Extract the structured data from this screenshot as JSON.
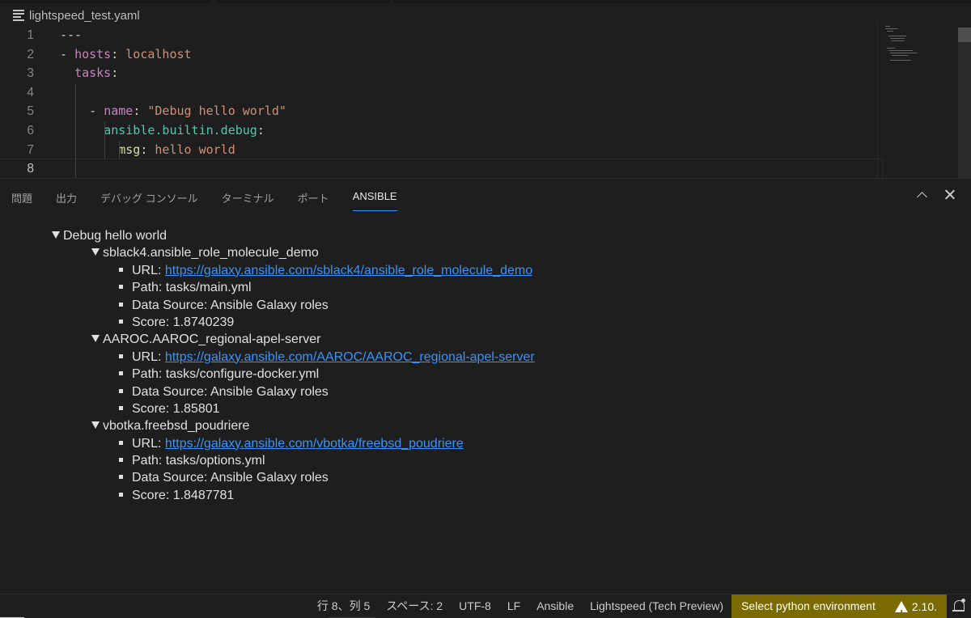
{
  "editor": {
    "filename": "lightspeed_test.yaml",
    "lines": [
      {
        "num": "1",
        "tokens": [
          [
            "plain",
            "---"
          ]
        ]
      },
      {
        "num": "2",
        "tokens": [
          [
            "dash",
            "- "
          ],
          [
            "k1",
            "hosts"
          ],
          [
            "plain",
            ": "
          ],
          [
            "str",
            "localhost"
          ]
        ]
      },
      {
        "num": "3",
        "tokens": [
          [
            "plain",
            "  "
          ],
          [
            "k1",
            "tasks"
          ],
          [
            "plain",
            ":"
          ]
        ]
      },
      {
        "num": "4",
        "tokens": []
      },
      {
        "num": "5",
        "tokens": [
          [
            "plain",
            "    "
          ],
          [
            "dash",
            "- "
          ],
          [
            "k1",
            "name"
          ],
          [
            "plain",
            ": "
          ],
          [
            "str",
            "\"Debug hello world\""
          ]
        ]
      },
      {
        "num": "6",
        "tokens": [
          [
            "plain",
            "      "
          ],
          [
            "k2",
            "ansible.builtin.debug"
          ],
          [
            "plain",
            ":"
          ]
        ]
      },
      {
        "num": "7",
        "tokens": [
          [
            "plain",
            "        "
          ],
          [
            "k3",
            "msg"
          ],
          [
            "plain",
            ": "
          ],
          [
            "str",
            "hello world"
          ]
        ]
      },
      {
        "num": "8",
        "tokens": []
      }
    ],
    "current_line": "8"
  },
  "panel": {
    "tabs": [
      {
        "label": "問題",
        "name": "tab-problems",
        "active": false
      },
      {
        "label": "出力",
        "name": "tab-output",
        "active": false
      },
      {
        "label": "デバッグ コンソール",
        "name": "tab-debug-console",
        "active": false
      },
      {
        "label": "ターミナル",
        "name": "tab-terminal",
        "active": false
      },
      {
        "label": "ポート",
        "name": "tab-ports",
        "active": false
      },
      {
        "label": "ANSIBLE",
        "name": "tab-ansible",
        "active": true
      }
    ],
    "tree": {
      "root": "Debug hello world",
      "roles": [
        {
          "name": "sblack4.ansible_role_molecule_demo",
          "url_label": "URL: ",
          "url": "https://galaxy.ansible.com/sblack4/ansible_role_molecule_demo",
          "path": "Path: tasks/main.yml",
          "source": "Data Source: Ansible Galaxy roles",
          "score": "Score: 1.8740239"
        },
        {
          "name": "AAROC.AAROC_regional-apel-server",
          "url_label": "URL: ",
          "url": "https://galaxy.ansible.com/AAROC/AAROC_regional-apel-server",
          "path": "Path: tasks/configure-docker.yml",
          "source": "Data Source: Ansible Galaxy roles",
          "score": "Score: 1.85801"
        },
        {
          "name": "vbotka.freebsd_poudriere",
          "url_label": "URL: ",
          "url": "https://galaxy.ansible.com/vbotka/freebsd_poudriere",
          "path": "Path: tasks/options.yml",
          "source": "Data Source: Ansible Galaxy roles",
          "score": "Score: 1.8487781"
        }
      ]
    }
  },
  "statusbar": {
    "position": "行 8、列 5",
    "spaces": "スペース: 2",
    "encoding": "UTF-8",
    "eol": "LF",
    "language": "Ansible",
    "lightspeed": "Lightspeed (Tech Preview)",
    "python_env": "Select python environment",
    "warning": "2.10.",
    "colors": {
      "highlight": "#7a6a00",
      "link": "#3794ff"
    }
  }
}
